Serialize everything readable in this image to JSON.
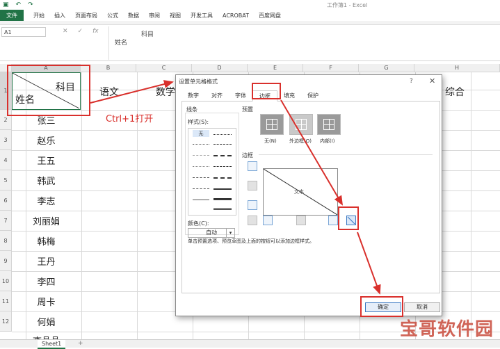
{
  "window": {
    "title": "工作簿1 - Excel"
  },
  "quick_access": {
    "save": "▣",
    "undo": "↶",
    "redo": "↷"
  },
  "ribbon": {
    "file": "文件",
    "tabs": [
      "开始",
      "插入",
      "页面布局",
      "公式",
      "数据",
      "审阅",
      "视图",
      "开发工具",
      "ACROBAT",
      "百度网盘"
    ]
  },
  "formula_bar": {
    "name_box": "A1",
    "cancel": "✕",
    "enter": "✓",
    "fx": "fx",
    "line1": "科目",
    "line2": "姓名"
  },
  "columns": [
    "A",
    "B",
    "C",
    "D",
    "E",
    "F",
    "G",
    "H"
  ],
  "rows": [
    "1",
    "2",
    "3",
    "4",
    "5",
    "6",
    "7",
    "8",
    "9",
    "10",
    "11",
    "12"
  ],
  "sheet": {
    "a1_top": "科目",
    "a1_bottom": "姓名",
    "header_b": "语文",
    "header_c": "数学",
    "header_h": "综合",
    "names": [
      "张三",
      "赵乐",
      "王五",
      "韩武",
      "李志",
      "刘丽娟",
      "韩梅",
      "王丹",
      "李四",
      "周卡",
      "何娟",
      "李晶晶"
    ]
  },
  "annotation": {
    "shortcut": "Ctrl+1打开",
    "color": "#d9302c"
  },
  "dialog": {
    "title": "设置单元格格式",
    "help": "?",
    "close": "✕",
    "tabs": [
      "数字",
      "对齐",
      "字体",
      "边框",
      "填充",
      "保护"
    ],
    "active_tab": "边框",
    "line_group": "线条",
    "style_label": "样式(S):",
    "style_none": "无",
    "color_label": "颜色(C):",
    "color_value": "自动",
    "preset_group": "预置",
    "presets": [
      "无(N)",
      "外边框(O)",
      "内部(I)"
    ],
    "border_group": "边框",
    "preview_text": "文本",
    "help_text": "单击预置选项、预览草图及上面的按钮可以添加边框样式。",
    "ok": "确定",
    "cancel": "取消"
  },
  "sheet_tabs": {
    "active": "Sheet1",
    "add": "+"
  },
  "watermark": "宝哥软件园"
}
